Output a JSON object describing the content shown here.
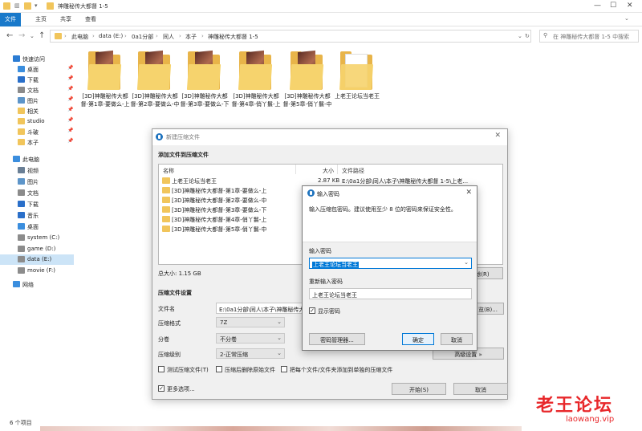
{
  "window": {
    "title": "神雕秘传大都督 1-5",
    "controls": [
      "—",
      "☐",
      "✕"
    ]
  },
  "ribbon": {
    "tabs": [
      "文件",
      "主页",
      "共享",
      "查看"
    ]
  },
  "address": {
    "crumbs": [
      "此电脑",
      "data (E:)",
      "0a1分部",
      "同人",
      "本子",
      "神雕秘传大都督 1-5"
    ],
    "search_placeholder": "在 神雕秘传大都督 1-5 中搜索"
  },
  "sidebar": {
    "items": [
      {
        "label": "快速访问",
        "icon": "star-icon",
        "color": "#2b7cd3"
      },
      {
        "label": "桌面",
        "icon": "desktop-icon",
        "color": "#3b8ede",
        "pin": true
      },
      {
        "label": "下载",
        "icon": "download-icon",
        "color": "#2a6fc9",
        "pin": true
      },
      {
        "label": "文档",
        "icon": "document-icon",
        "color": "#8b8b8b",
        "pin": true
      },
      {
        "label": "图片",
        "icon": "pictures-icon",
        "color": "#5d95c9",
        "pin": true
      },
      {
        "label": "相关",
        "icon": "folder-icon",
        "color": "#f1c55b",
        "pin": true
      },
      {
        "label": "studio",
        "icon": "folder-icon",
        "color": "#f1c55b",
        "pin": true
      },
      {
        "label": "斗破",
        "icon": "folder-icon",
        "color": "#f1c55b",
        "pin": true
      },
      {
        "label": "本子",
        "icon": "folder-icon",
        "color": "#f1c55b",
        "pin": true
      },
      {
        "label": "此电脑",
        "icon": "pc-icon",
        "color": "#3b8ede"
      },
      {
        "label": "视频",
        "icon": "video-icon",
        "color": "#6a7f95"
      },
      {
        "label": "图片",
        "icon": "pictures-icon",
        "color": "#5d95c9"
      },
      {
        "label": "文档",
        "icon": "document-icon",
        "color": "#8b8b8b"
      },
      {
        "label": "下载",
        "icon": "download-icon",
        "color": "#2a6fc9"
      },
      {
        "label": "音乐",
        "icon": "music-icon",
        "color": "#2a6fc9"
      },
      {
        "label": "桌面",
        "icon": "desktop-icon",
        "color": "#3b8ede"
      },
      {
        "label": "system (C:)",
        "icon": "drive-icon",
        "color": "#8c8c8c"
      },
      {
        "label": "game (D:)",
        "icon": "drive-icon",
        "color": "#8c8c8c"
      },
      {
        "label": "data (E:)",
        "icon": "drive-icon",
        "color": "#8c8c8c",
        "selected": true
      },
      {
        "label": "movie (F:)",
        "icon": "drive-icon",
        "color": "#8c8c8c"
      },
      {
        "label": "网络",
        "icon": "network-icon",
        "color": "#3b8ede"
      }
    ]
  },
  "folders": [
    {
      "label": "[3D]神雕秘传大都督-第1章-要做么-上"
    },
    {
      "label": "[3D]神雕秘传大都督-第2章-要做么-中"
    },
    {
      "label": "[3D]神雕秘传大都督-第3章-要做么-下"
    },
    {
      "label": "[3D]神雕秘传大都督-第4章-俏丫鬟-上"
    },
    {
      "label": "[3D]神雕秘传大都督-第5章-俏丫鬟-中"
    },
    {
      "label": "上老王论坛当老王"
    }
  ],
  "status": {
    "count": "6 个项目"
  },
  "archive_dialog": {
    "title": "新建压缩文件",
    "add_files_heading": "添加文件到压缩文件",
    "columns": {
      "name": "名称",
      "size": "大小",
      "path": "文件路径"
    },
    "files": [
      {
        "name": "上老王论坛当老王",
        "size": "2.87 KB",
        "path": "E:\\0a1分部\\同人\\本子\\神雕秘传大都督 1-5\\上老..."
      },
      {
        "name": "[3D]神雕秘传大都督-第1章-要做么-上",
        "size": "",
        "path": ""
      },
      {
        "name": "[3D]神雕秘传大都督-第2章-要做么-中",
        "size": "",
        "path": ""
      },
      {
        "name": "[3D]神雕秘传大都督-第3章-要做么-下",
        "size": "",
        "path": ""
      },
      {
        "name": "[3D]神雕秘传大都督-第4章-俏丫鬟-上",
        "size": "",
        "path": ""
      },
      {
        "name": "[3D]神雕秘传大都督-第5章-俏丫鬟-中",
        "size": "",
        "path": ""
      }
    ],
    "total_size": "总大小: 1.15 GB",
    "remove_button": "除(R)",
    "settings_heading": "压缩文件设置",
    "filename_label": "文件名",
    "filename_value": "E:\\0a1分部\\同人\\本子\\神雕秘传大都督 1-5.7z",
    "browse_button": "览(B)...",
    "format_label": "压缩格式",
    "format_value": "7Z",
    "volume_label": "分卷",
    "volume_value": "不分卷",
    "level_label": "压缩级别",
    "level_value": "2-正常压缩",
    "advanced_button": "高级设置 »",
    "test_checkbox": "测试压缩文件(T)",
    "delete_checkbox": "压缩后删除原始文件",
    "separate_checkbox": "把每个文件/文件夹添加到单独的压缩文件",
    "more_checkbox": "更多选项...",
    "start_button": "开始(S)",
    "cancel_button": "取消"
  },
  "password_dialog": {
    "title": "输入密码",
    "message": "输入压缩包密码。建议使用至少 8 位的密码来保证安全性。",
    "password_label": "输入密码",
    "password_value": "上老王论坛当老王",
    "confirm_label": "重新输入密码",
    "confirm_value": "上老王论坛当老王",
    "show_password": "显示密码",
    "manager_button": "密码管理器...",
    "ok_button": "确定",
    "cancel_button": "取消"
  },
  "watermark": {
    "text": "老王论坛",
    "url": "laowang.vip"
  }
}
